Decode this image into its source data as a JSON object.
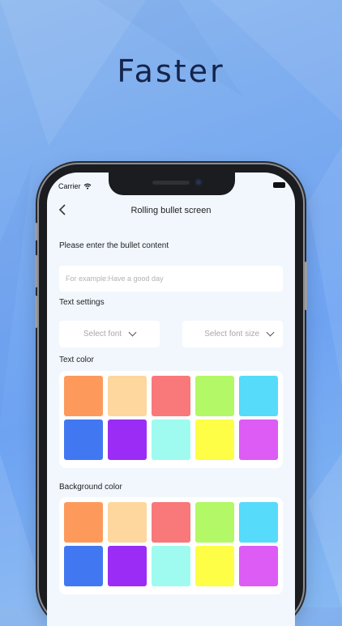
{
  "headline": "Faster",
  "status": {
    "carrier": "Carrier"
  },
  "navbar": {
    "back_icon": "chevron-left-icon",
    "title": "Rolling bullet screen"
  },
  "content_section": {
    "label": "Please enter the bullet content",
    "input_value": "",
    "input_placeholder": "For example:Have a good day"
  },
  "text_settings": {
    "label": "Text settings",
    "font_select": "Select font",
    "font_size_select": "Select font size"
  },
  "text_color": {
    "label": "Text color",
    "colors": [
      "#fd9a5b",
      "#fdd79d",
      "#f9787a",
      "#b3f866",
      "#56dbfb",
      "#4178f2",
      "#9a2cf5",
      "#9ffbf0",
      "#fdfe45",
      "#dc5cf5"
    ]
  },
  "background_color": {
    "label": "Background color",
    "colors": [
      "#fd9a5b",
      "#fdd79d",
      "#f9787a",
      "#b3f866",
      "#56dbfb",
      "#4178f2",
      "#9a2cf5",
      "#9ffbf0",
      "#fdfe45",
      "#dc5cf5"
    ]
  }
}
